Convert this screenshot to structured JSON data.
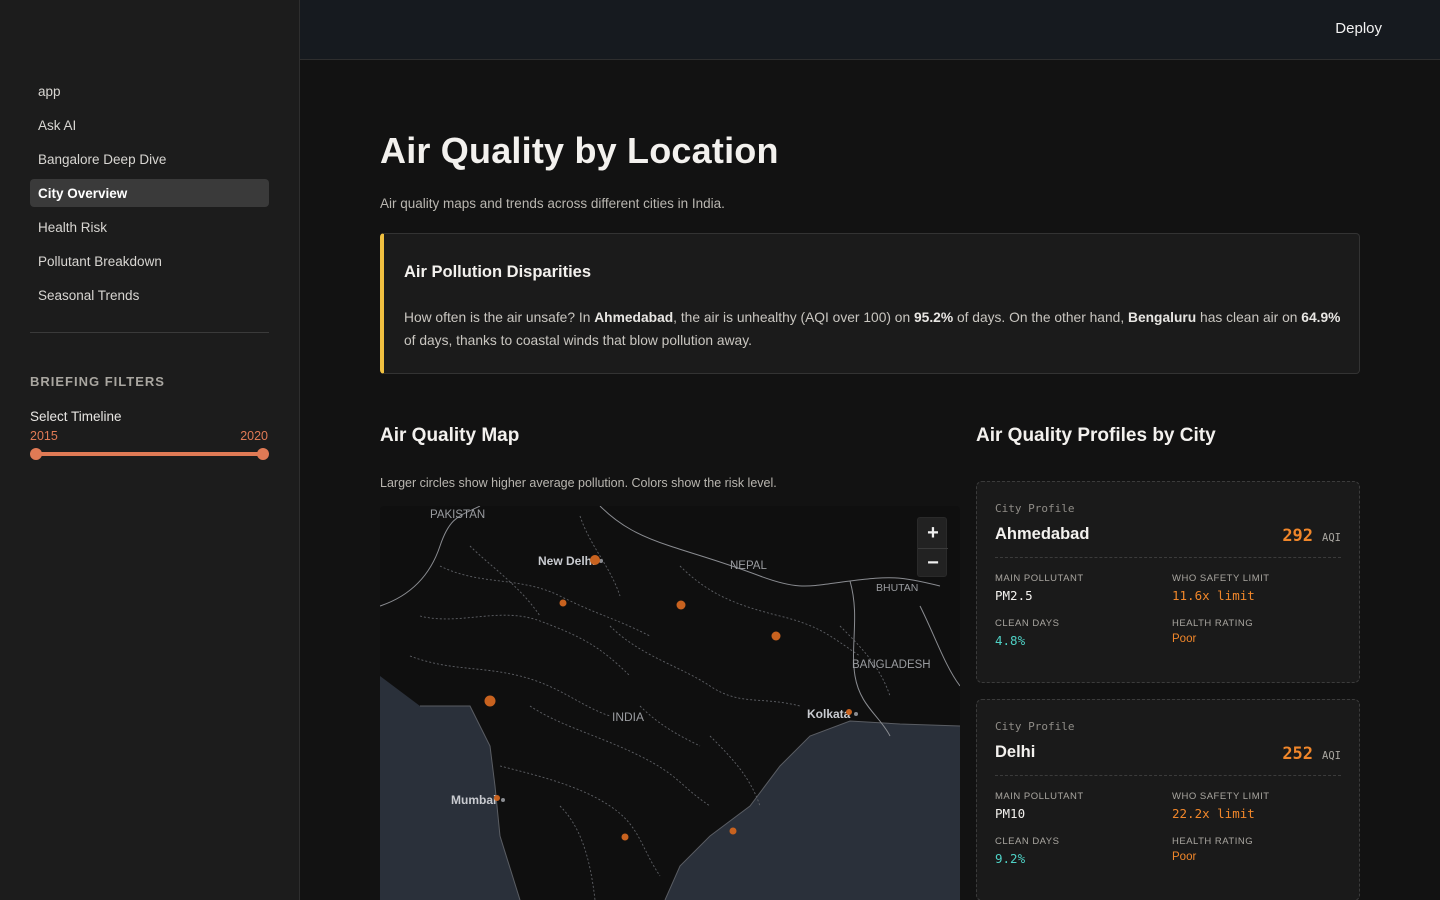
{
  "sidebar": {
    "nav": [
      {
        "label": "app",
        "active": false
      },
      {
        "label": "Ask AI",
        "active": false
      },
      {
        "label": "Bangalore Deep Dive",
        "active": false
      },
      {
        "label": "City Overview",
        "active": true
      },
      {
        "label": "Health Risk",
        "active": false
      },
      {
        "label": "Pollutant Breakdown",
        "active": false
      },
      {
        "label": "Seasonal Trends",
        "active": false
      }
    ],
    "filters_title": "BRIEFING FILTERS",
    "timeline": {
      "label": "Select Timeline",
      "min": "2015",
      "max": "2020"
    }
  },
  "header": {
    "deploy_label": "Deploy"
  },
  "main": {
    "title": "Air Quality by Location",
    "subtitle": "Air quality maps and trends across different cities in India.",
    "callout": {
      "title": "Air Pollution Disparities",
      "body_parts": [
        {
          "text": "How often is the air unsafe? In ",
          "bold": false
        },
        {
          "text": "Ahmedabad",
          "bold": true
        },
        {
          "text": ", the air is unhealthy (AQI over 100) on ",
          "bold": false
        },
        {
          "text": "95.2%",
          "bold": true
        },
        {
          "text": " of days. On the other hand, ",
          "bold": false
        },
        {
          "text": "Bengaluru",
          "bold": true
        },
        {
          "text": " has clean air on ",
          "bold": false
        },
        {
          "text": "64.9%",
          "bold": true
        },
        {
          "text": " of days, thanks to coastal winds that blow pollution away.",
          "bold": false
        }
      ]
    },
    "map_section": {
      "title": "Air Quality Map",
      "caption": "Larger circles show higher average pollution. Colors show the risk level.",
      "labels": {
        "pakistan": "PAKISTAN",
        "nepal": "NEPAL",
        "bhutan": "BHUTAN",
        "bangladesh": "BANGLADESH",
        "india": "INDIA",
        "new_delhi": "New Delhi",
        "kolkata": "Kolkata",
        "mumbai": "Mumbai"
      },
      "zoom_in": "+",
      "zoom_out": "−",
      "marker_color": "#c8621f"
    },
    "profiles_section": {
      "title": "Air Quality Profiles by City",
      "cards": [
        {
          "kicker": "City Profile",
          "city": "Ahmedabad",
          "aqi": "292",
          "aqi_unit": "AQI",
          "main_pollutant_label": "MAIN POLLUTANT",
          "main_pollutant": "PM2.5",
          "who_label": "WHO SAFETY LIMIT",
          "who_value": "11.6x limit",
          "clean_days_label": "CLEAN DAYS",
          "clean_days": "4.8%",
          "rating_label": "HEALTH RATING",
          "rating": "Poor"
        },
        {
          "kicker": "City Profile",
          "city": "Delhi",
          "aqi": "252",
          "aqi_unit": "AQI",
          "main_pollutant_label": "MAIN POLLUTANT",
          "main_pollutant": "PM10",
          "who_label": "WHO SAFETY LIMIT",
          "who_value": "22.2x limit",
          "clean_days_label": "CLEAN DAYS",
          "clean_days": "9.2%",
          "rating_label": "HEALTH RATING",
          "rating": "Poor"
        }
      ]
    }
  },
  "colors": {
    "accent": "#e07a55",
    "callout_border": "#f0c040",
    "aqi": "#f0862a",
    "clean_days": "#4fd1c5"
  }
}
